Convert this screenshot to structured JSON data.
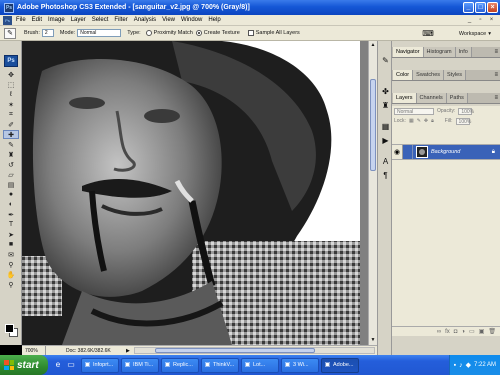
{
  "titlebar": {
    "app_icon": "Ps",
    "title": "Adobe Photoshop CS3 Extended - [sanguitar_v2.jpg @ 700% (Gray/8)]",
    "buttons": [
      "minimize-icon",
      "maximize-icon",
      "close-icon"
    ]
  },
  "menubar": {
    "items": [
      "File",
      "Edit",
      "Image",
      "Layer",
      "Select",
      "Filter",
      "Analysis",
      "View",
      "Window",
      "Help"
    ]
  },
  "options": {
    "brush_label": "Brush:",
    "brush_value": "2",
    "mode_label": "Mode:",
    "mode_value": "Normal",
    "type_label": "Type:",
    "proximity_label": "Proximity Match",
    "texture_label": "Create Texture",
    "sample_all_label": "Sample All Layers",
    "workspace_label": "Workspace"
  },
  "toolbox": {
    "badge": "Ps",
    "tools": [
      "move-tool-icon",
      "marquee-tool-icon",
      "lasso-tool-icon",
      "magic-wand-icon",
      "crop-tool-icon",
      "eyedropper-icon",
      "spot-healing-brush-icon",
      "brush-tool-icon",
      "clone-stamp-icon",
      "history-brush-icon",
      "eraser-icon",
      "gradient-tool-icon",
      "blur-tool-icon",
      "dodge-tool-icon",
      "pen-tool-icon",
      "type-tool-icon",
      "path-selection-icon",
      "rectangle-tool-icon",
      "notes-tool-icon",
      "eyedropper-2-icon",
      "hand-tool-icon",
      "zoom-tool-icon"
    ],
    "active_tool": "spot-healing-brush-icon",
    "foreground_color": "#000000",
    "background_color": "#ffffff"
  },
  "status": {
    "zoom": "700%",
    "doc": "Doc: 382.6K/382.6K"
  },
  "panels": {
    "group1_tabs": [
      "Navigator",
      "Histogram",
      "Info"
    ],
    "group2_tabs": [
      "Color",
      "Swatches",
      "Styles"
    ],
    "group3_tabs": [
      "Layers",
      "Channels",
      "Paths"
    ],
    "blend_mode": "Normal",
    "opacity_label": "Opacity:",
    "opacity_value": "100%",
    "lock_label": "Lock:",
    "fill_label": "Fill:",
    "fill_value": "100%",
    "layer_name": "Background"
  },
  "taskbar": {
    "start_label": "start",
    "tasks": [
      "Infoprt...",
      "IBM Ti...",
      "Replic...",
      "ThinkV...",
      "Lot...",
      "3 Wi...",
      "Adobe..."
    ],
    "active_task": "Adobe...",
    "time": "7:22 AM"
  },
  "colors": {
    "xp_blue": "#245edb",
    "layer_selected": "#3a62b8",
    "panel_bg": "#ece9d8"
  }
}
